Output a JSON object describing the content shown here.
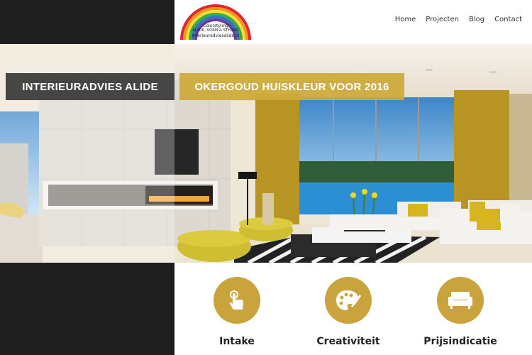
{
  "logo": {
    "line1": "Colorstyling",
    "line2": "KLEUR, VORM & STYLING",
    "line3": "interieuradviesalide.nl"
  },
  "nav": {
    "items": [
      "Home",
      "Projecten",
      "Blog",
      "Contact"
    ]
  },
  "hero": {
    "banner_left": "INTERIEURADVIES ALIDE",
    "banner_right": "OKERGOUD HUISKLEUR VOOR 2016"
  },
  "features": [
    {
      "label": "Intake",
      "icon": "hand-tap-icon"
    },
    {
      "label": "Creativiteit",
      "icon": "palette-icon"
    },
    {
      "label": "Prijsindicatie",
      "icon": "sofa-icon"
    }
  ],
  "colors": {
    "accent_gold": "#c9a43c",
    "dark": "#1f1f1f",
    "banner_dark": "#373737"
  }
}
